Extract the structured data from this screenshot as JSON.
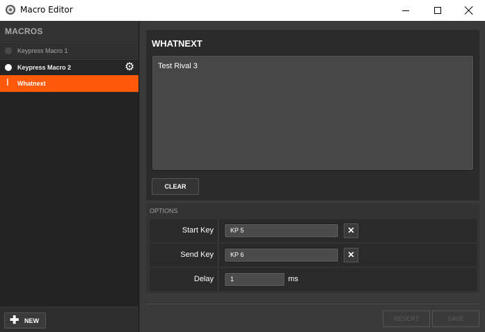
{
  "window": {
    "title": "Macro Editor",
    "controls": {
      "minimize_icon": "minimize-icon",
      "maximize_icon": "maximize-icon",
      "close_icon": "close-icon"
    }
  },
  "sidebar": {
    "title": "MACROS",
    "items": [
      {
        "label": "Keypress Macro 1",
        "state": "inactive"
      },
      {
        "label": "Keypress Macro 2",
        "state": "active"
      },
      {
        "label": "Whatnext",
        "state": "editing"
      }
    ],
    "new_button": {
      "icon": "plus-icon",
      "label": "NEW"
    }
  },
  "editor": {
    "title": "WHATNEXT",
    "text": "Test Rival 3",
    "clear_label": "CLEAR"
  },
  "options": {
    "title": "OPTIONS",
    "start_key": {
      "label": "Start Key",
      "value": "KP 5"
    },
    "send_key": {
      "label": "Send Key",
      "value": "KP 6"
    },
    "delay": {
      "label": "Delay",
      "value": "1",
      "unit": "ms"
    }
  },
  "footer": {
    "revert_label": "REVERT",
    "save_label": "SAVE"
  },
  "colors": {
    "accent": "#ff5a0a",
    "background": "#3a3a3a",
    "panel": "#2b2b2b"
  }
}
